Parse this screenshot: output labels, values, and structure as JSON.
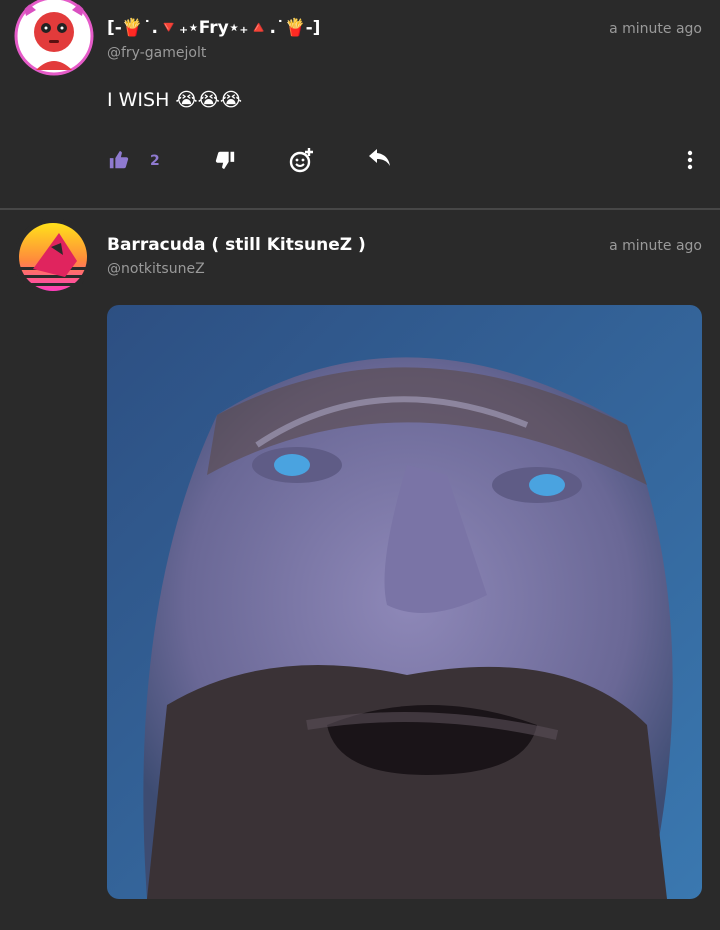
{
  "posts": [
    {
      "display_name": "[-🍟˙.🔻₊⋆Fry⋆₊🔺.˙🍟-]",
      "username": "@fry-gamejolt",
      "timestamp": "a minute ago",
      "text": "I WISH 😭😭😭",
      "likes": "2",
      "avatar_icon": "devil-avatar",
      "colors": {
        "accent": "#8f7ad0",
        "avatar_ring": "#e55bc8"
      }
    },
    {
      "display_name": "Barracuda ( still KitsuneZ )",
      "username": "@notkitsuneZ",
      "timestamp": "a minute ago",
      "avatar_icon": "fox-sunset-avatar",
      "media_alt": "Close-up of a bearded man looking upward"
    }
  ],
  "icons": {
    "like": "thumbs-up-icon",
    "dislike": "thumbs-down-icon",
    "react": "add-reaction-icon",
    "reply": "reply-icon",
    "more": "more-vertical-icon"
  }
}
